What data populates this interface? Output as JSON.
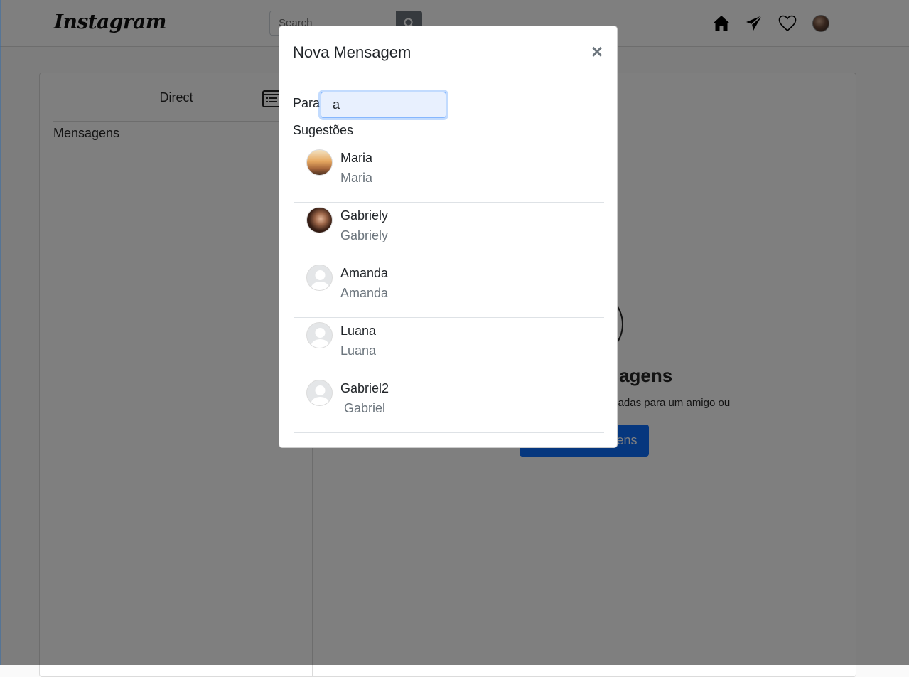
{
  "nav": {
    "logo": "Instagram",
    "search_placeholder": "Search",
    "icons": [
      "home-icon",
      "paper-plane-icon",
      "heart-icon",
      "profile-avatar"
    ]
  },
  "direct": {
    "title": "Direct",
    "section": "Mensagens",
    "empty_title": "Suas mensagens",
    "empty_subtitle": "Envie fotos e mensagens privadas para um amigo ou grupo.",
    "empty_button": "Enviar mensagens"
  },
  "modal": {
    "title": "Nova Mensagem",
    "close": "×",
    "to_label": "Para:",
    "to_value": "a",
    "suggestions_label": "Sugestões",
    "suggestions": [
      {
        "name": "Maria",
        "username": "Maria",
        "avatar": "photo"
      },
      {
        "name": "Gabriely",
        "username": "Gabriely",
        "avatar": "photo"
      },
      {
        "name": "Amanda",
        "username": "Amanda",
        "avatar": "default"
      },
      {
        "name": "Luana",
        "username": "Luana",
        "avatar": "default"
      },
      {
        "name": "Gabriel2",
        "username": " Gabriel",
        "avatar": "default"
      }
    ]
  },
  "colors": {
    "primary": "#0d6efd",
    "backdrop": "rgba(0,0,0,0.5)",
    "muted": "#6c757d"
  }
}
